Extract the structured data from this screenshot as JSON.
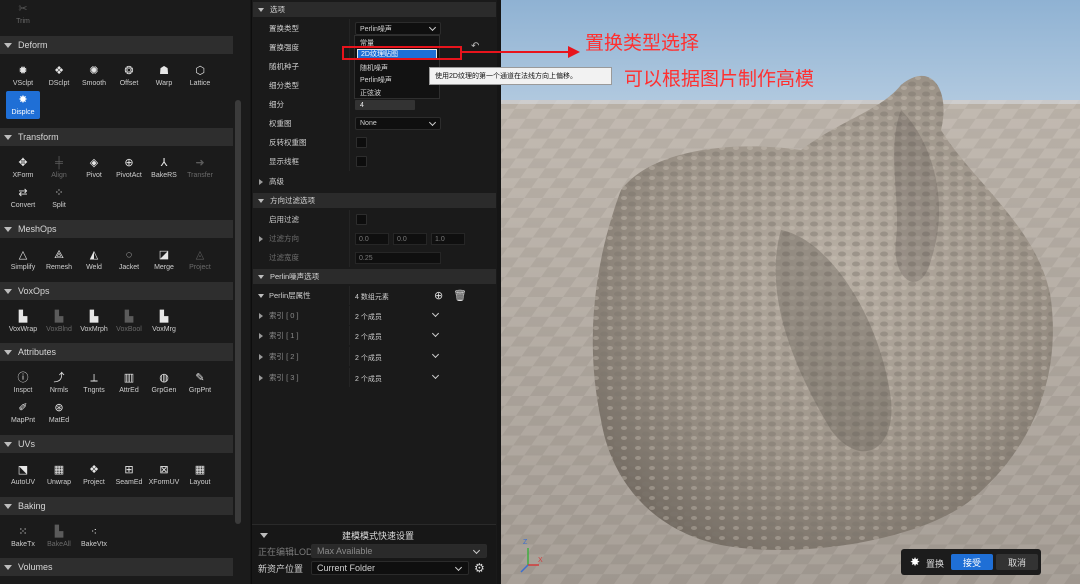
{
  "palette": {
    "top_tool": "Trim",
    "categories": [
      {
        "title": "Deform",
        "tools": [
          "VSclpt",
          "DSclpt",
          "Smooth",
          "Offset",
          "Warp",
          "Lattice",
          "Displce"
        ]
      },
      {
        "title": "Transform",
        "tools": [
          "XForm",
          "Align",
          "Pivot",
          "PivotAct",
          "BakeRS",
          "Transfer",
          "Convert",
          "Split"
        ]
      },
      {
        "title": "MeshOps",
        "tools": [
          "Simplify",
          "Remesh",
          "Weld",
          "Jacket",
          "Merge",
          "Project"
        ]
      },
      {
        "title": "VoxOps",
        "tools": [
          "VoxWrap",
          "VoxBlnd",
          "VoxMrph",
          "VoxBool",
          "VoxMrg"
        ]
      },
      {
        "title": "Attributes",
        "tools": [
          "Inspct",
          "Nrmls",
          "Tngnts",
          "AttrEd",
          "GrpGen",
          "GrpPnt",
          "MapPnt",
          "MatEd"
        ]
      },
      {
        "title": "UVs",
        "tools": [
          "AutoUV",
          "Unwrap",
          "Project",
          "SeamEd",
          "XFormUV",
          "Layout"
        ]
      },
      {
        "title": "Baking",
        "tools": [
          "BakeTx",
          "BakeAll",
          "BakeVtx"
        ]
      },
      {
        "title": "Volumes",
        "tools": []
      }
    ]
  },
  "details": {
    "options_title": "选项",
    "displace_type_label": "置换类型",
    "displace_type_value": "Perlin噪声",
    "intensity_label": "置换强度",
    "seed_label": "随机种子",
    "subdiv_type_label": "细分类型",
    "subdiv_label": "细分",
    "subdiv_value": "4",
    "weight_map_label": "权重图",
    "weight_map_value": "None",
    "invert_weight_label": "反转权重图",
    "show_wire_label": "显示线框",
    "advanced_title": "高级",
    "dir_filter_title": "方向过滤选项",
    "enable_filter_label": "启用过滤",
    "filter_dir_label": "过滤方向",
    "filter_dir_x": "0.0",
    "filter_dir_y": "0.0",
    "filter_dir_z": "1.0",
    "filter_width_label": "过滤宽度",
    "filter_width_value": "0.25",
    "perlin_title": "Perlin噪声选项",
    "perlin_layers_label": "Perlin层属性",
    "perlin_layers_value": "4 数组元素",
    "index_rows": [
      {
        "label": "索引 [ 0 ]",
        "value": "2 个成员"
      },
      {
        "label": "索引 [ 1 ]",
        "value": "2 个成员"
      },
      {
        "label": "索引 [ 2 ]",
        "value": "2 个成员"
      },
      {
        "label": "索引 [ 3 ]",
        "value": "2 个成员"
      }
    ]
  },
  "dropdown": {
    "options": [
      "常量",
      "2D纹理贴图",
      "随机噪声",
      "Perlin噪声",
      "正弦波"
    ],
    "selected_index": 1
  },
  "tooltip": "使用2D纹理的第一个通道在法线方向上偏移。",
  "quick_settings": {
    "title": "建模模式快速设置",
    "lod_label": "正在编辑LOD",
    "lod_value": "Max Available",
    "asset_label": "新资产位置",
    "asset_value": "Current Folder"
  },
  "annotations": {
    "arrow_text": "置换类型选择",
    "note_text": "可以根据图片制作高模",
    "color": "#ff3030"
  },
  "accept_bar": {
    "label": "置换",
    "accept": "接受",
    "cancel": "取消"
  },
  "gizmo": {
    "x": "X",
    "z": "Z"
  }
}
